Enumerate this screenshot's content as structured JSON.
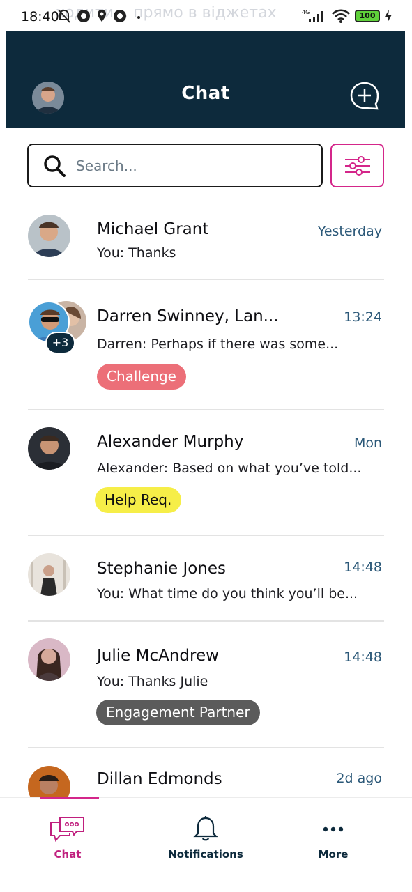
{
  "status_bar": {
    "time": "18:40",
    "ghost_text": "ходити... прямо в віджетах",
    "network": "4G",
    "battery": "100"
  },
  "header": {
    "title": "Chat"
  },
  "search": {
    "placeholder": "Search..."
  },
  "chats": [
    {
      "name": "Michael Grant",
      "time": "Yesterday",
      "preview": "You: Thanks",
      "tag": ""
    },
    {
      "name": "Darren Swinney, Lan...",
      "time": "13:24",
      "preview": "Darren: Perhaps if there was some...",
      "tag": "Challenge",
      "extra_count": "+3"
    },
    {
      "name": "Alexander Murphy",
      "time": "Mon",
      "preview": "Alexander: Based on what you’ve told...",
      "tag": "Help Req."
    },
    {
      "name": "Stephanie Jones",
      "time": "14:48",
      "preview": "You: What time do you think you’ll be...",
      "tag": ""
    },
    {
      "name": "Julie McAndrew",
      "time": "14:48",
      "preview": "You: Thanks Julie",
      "tag": "Engagement Partner"
    },
    {
      "name": "Dillan Edmonds",
      "time": "2d ago",
      "preview": "",
      "tag": ""
    }
  ],
  "nav": {
    "chat_label": "Chat",
    "notifications_label": "Notifications",
    "more_label": "More"
  },
  "colors": {
    "header_bg": "#0d2a3c",
    "accent": "#d4268a",
    "time_text": "#2b5878",
    "tag_challenge": "#ec6f78",
    "tag_help": "#f6ee48",
    "tag_partner": "#5b5b5b"
  }
}
